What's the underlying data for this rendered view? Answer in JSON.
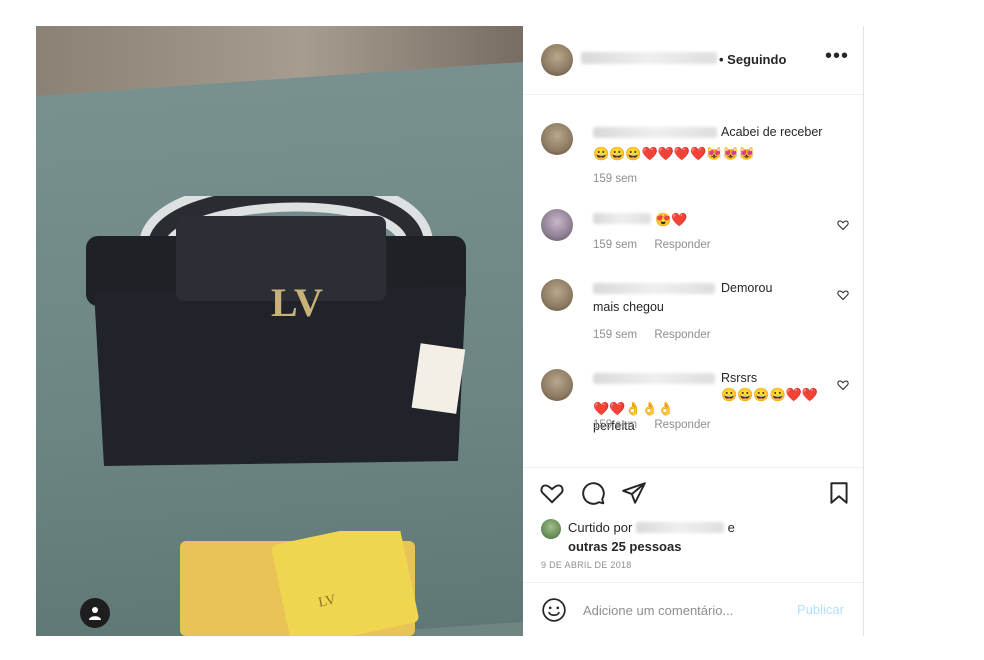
{
  "post": {
    "header": {
      "follow_label": "• Seguindo",
      "more_label": "•••"
    },
    "comments": [
      {
        "text": "Acabei de receber",
        "emojis": "😀😀😀❤️❤️❤️❤️😻😻😻",
        "time": "159 sem",
        "reply": ""
      },
      {
        "text": "",
        "emojis": "😍❤️",
        "time": "159 sem",
        "reply": "Responder"
      },
      {
        "text": "Demorou mais chegou",
        "emojis": "",
        "time": "159 sem",
        "reply": "Responder"
      },
      {
        "text": "Rsrsrs",
        "emojis": "😀😀😀😀❤️❤️❤️❤️👌👌👌",
        "suffix": "perfeita",
        "time": "159 sem",
        "reply": "Responder"
      }
    ],
    "likes": {
      "prefix": "Curtido por",
      "suffix": "e",
      "count_text": "outras 25 pessoas"
    },
    "date": "9 DE ABRIL DE 2018",
    "add_comment": {
      "placeholder": "Adicione um comentário...",
      "publish_label": "Publicar"
    }
  }
}
